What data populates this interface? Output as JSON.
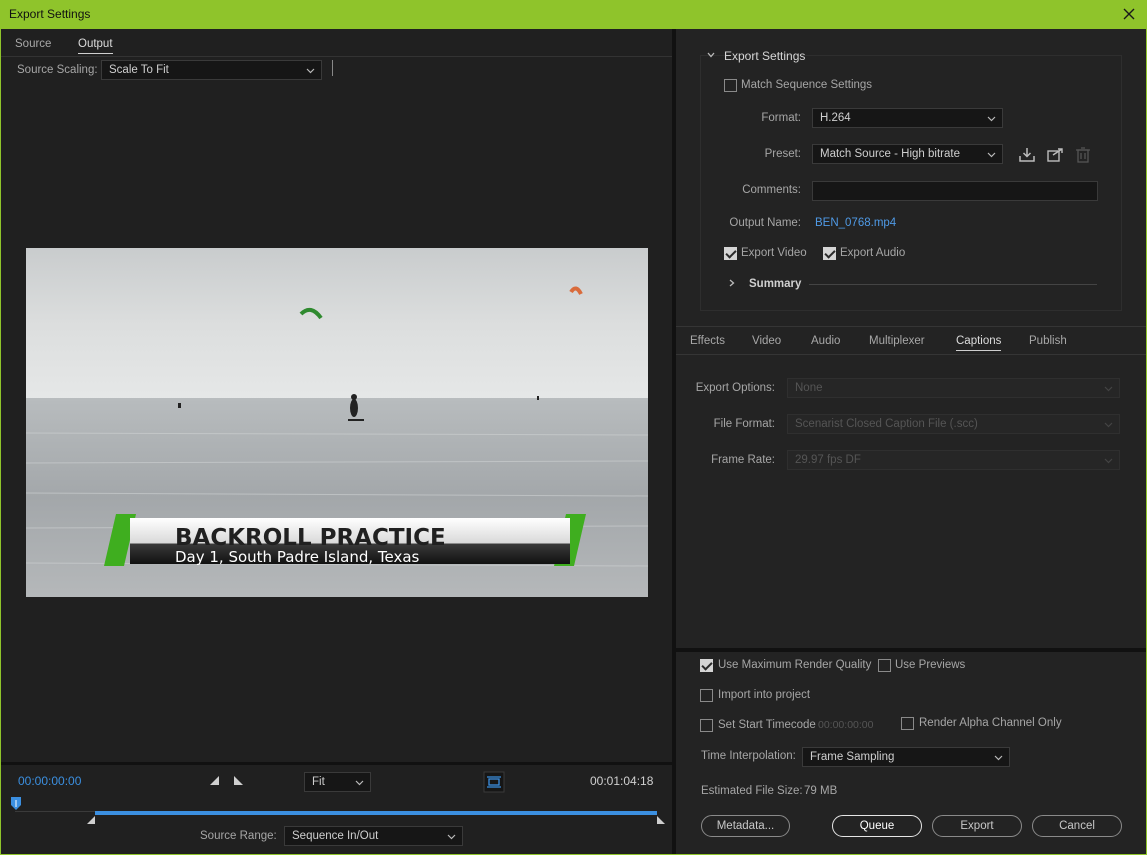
{
  "window": {
    "title": "Export Settings"
  },
  "left_tabs": {
    "source": "Source",
    "output": "Output"
  },
  "source_scaling": {
    "label": "Source Scaling:",
    "value": "Scale To Fit"
  },
  "preview": {
    "headline": "BACKROLL PRACTICE",
    "subline": "Day 1, South Padre Island, Texas"
  },
  "timeline": {
    "current_time": "00:00:00:00",
    "duration": "00:01:04:18",
    "zoom": "Fit",
    "source_range_label": "Source Range:",
    "source_range_value": "Sequence In/Out"
  },
  "export_settings": {
    "section_title": "Export Settings",
    "match_sequence": "Match Sequence Settings",
    "format_label": "Format:",
    "format_value": "H.264",
    "preset_label": "Preset:",
    "preset_value": "Match Source - High bitrate",
    "comments_label": "Comments:",
    "comments_value": "",
    "output_name_label": "Output Name:",
    "output_name_value": "BEN_0768.mp4",
    "export_video": "Export Video",
    "export_audio": "Export Audio",
    "summary": "Summary"
  },
  "settings_tabs": [
    "Effects",
    "Video",
    "Audio",
    "Multiplexer",
    "Captions",
    "Publish"
  ],
  "captions": {
    "export_options_label": "Export Options:",
    "export_options_value": "None",
    "file_format_label": "File Format:",
    "file_format_value": "Scenarist Closed Caption File (.scc)",
    "frame_rate_label": "Frame Rate:",
    "frame_rate_value": "29.97 fps DF"
  },
  "bottom": {
    "max_render_quality": "Use Maximum Render Quality",
    "use_previews": "Use Previews",
    "import_project": "Import into project",
    "set_start_timecode": "Set Start Timecode",
    "start_timecode_value": "00:00:00:00",
    "render_alpha": "Render Alpha Channel Only",
    "time_interp_label": "Time Interpolation:",
    "time_interp_value": "Frame Sampling",
    "est_size_label": "Estimated File Size:",
    "est_size_value": "79 MB"
  },
  "buttons": {
    "metadata": "Metadata...",
    "queue": "Queue",
    "export": "Export",
    "cancel": "Cancel"
  },
  "colors": {
    "title_bar": "#8fc42b",
    "accent_blue": "#3b8fe0",
    "highlight_green": "#3fae1f"
  }
}
